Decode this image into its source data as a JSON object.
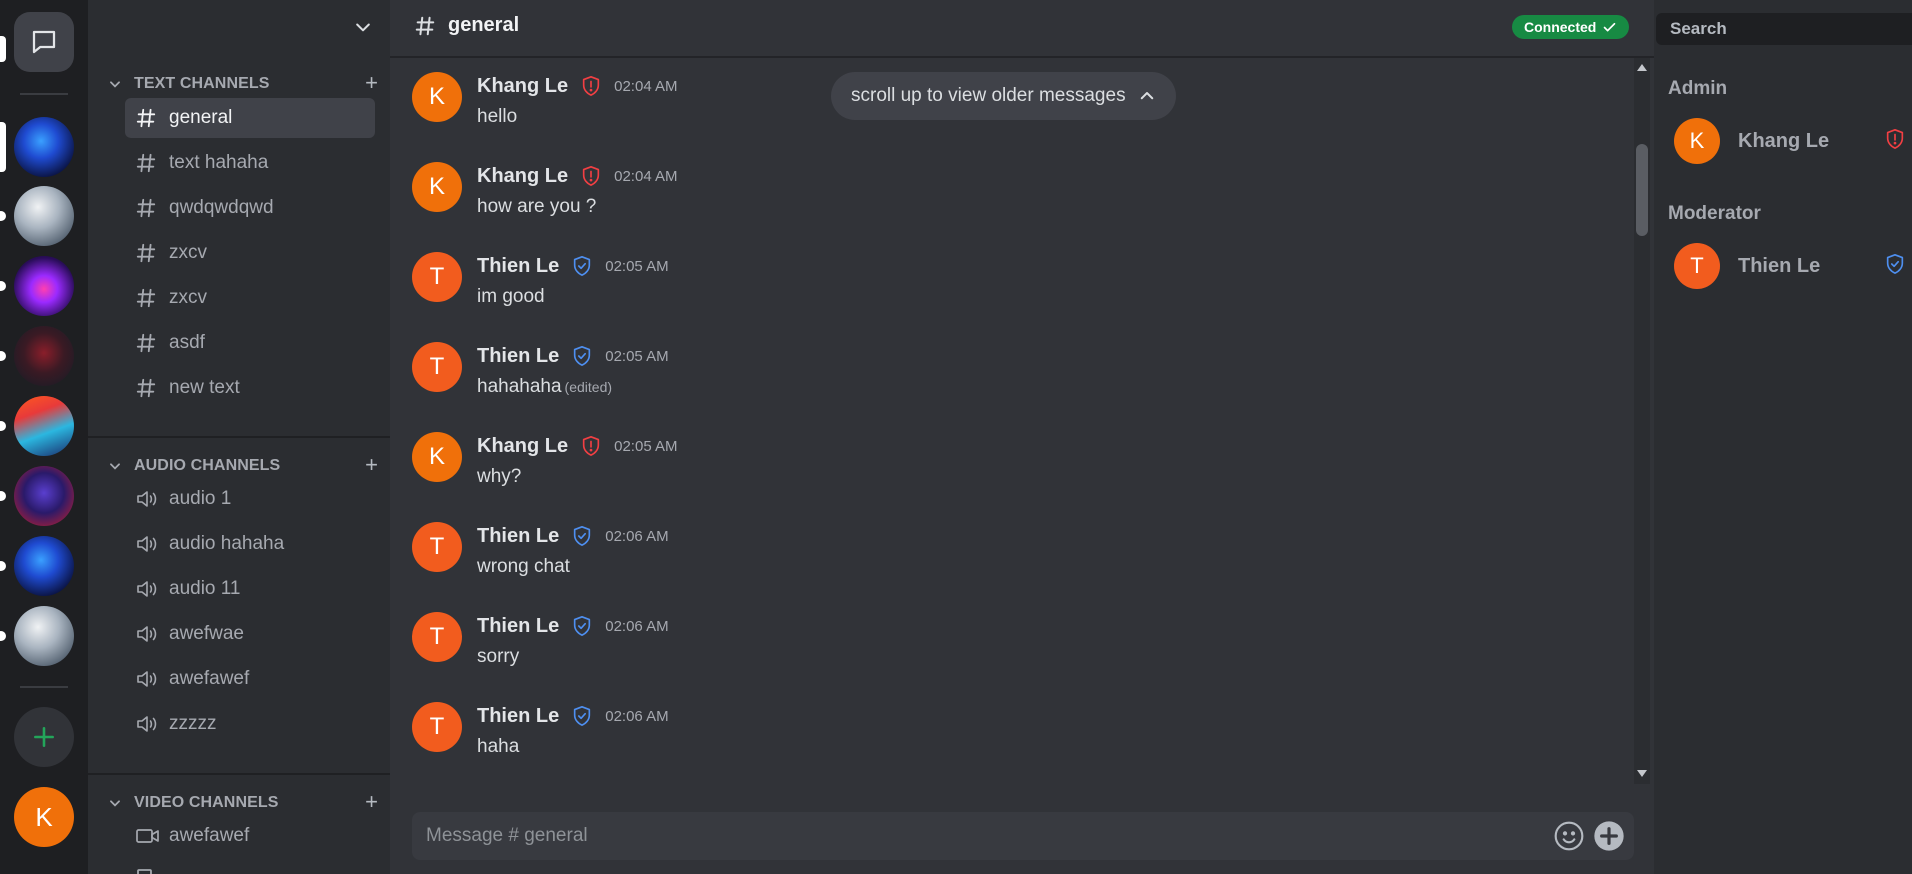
{
  "rail": {
    "tooltip": "conversation",
    "user_initial": "K",
    "server_count": 8
  },
  "sidebar": {
    "text_category": "TEXT CHANNELS",
    "text_channels": [
      "general",
      "text hahaha",
      "qwdqwdqwd",
      "zxcv",
      "zxcv",
      "asdf",
      "new text"
    ],
    "audio_category": "AUDIO CHANNELS",
    "audio_channels": [
      "audio 1",
      "audio hahaha",
      "audio 11",
      "awefwae",
      "awefawef",
      "zzzzz"
    ],
    "video_category": "VIDEO CHANNELS",
    "video_channels": [
      "awefawef"
    ]
  },
  "main": {
    "channel_title": "general",
    "status": "Connected",
    "scroll_hint": "scroll up to view older messages",
    "messages": [
      {
        "author": "Khang Le",
        "initial": "K",
        "role": "admin",
        "time": "02:04 AM",
        "text": "hello",
        "edited": ""
      },
      {
        "author": "Khang Le",
        "initial": "K",
        "role": "admin",
        "time": "02:04 AM",
        "text": "how are you ?",
        "edited": ""
      },
      {
        "author": "Thien Le",
        "initial": "T",
        "role": "moderator",
        "time": "02:05 AM",
        "text": "im good",
        "edited": ""
      },
      {
        "author": "Thien Le",
        "initial": "T",
        "role": "moderator",
        "time": "02:05 AM",
        "text": "hahahaha",
        "edited": "(edited)"
      },
      {
        "author": "Khang Le",
        "initial": "K",
        "role": "admin",
        "time": "02:05 AM",
        "text": "why?",
        "edited": ""
      },
      {
        "author": "Thien Le",
        "initial": "T",
        "role": "moderator",
        "time": "02:06 AM",
        "text": "wrong chat",
        "edited": ""
      },
      {
        "author": "Thien Le",
        "initial": "T",
        "role": "moderator",
        "time": "02:06 AM",
        "text": "sorry",
        "edited": ""
      },
      {
        "author": "Thien Le",
        "initial": "T",
        "role": "moderator",
        "time": "02:06 AM",
        "text": "haha",
        "edited": ""
      }
    ],
    "composer_placeholder": "Message # general"
  },
  "members": {
    "search_placeholder": "Search",
    "admin_title": "Admin",
    "admin": {
      "name": "Khang Le",
      "initial": "K"
    },
    "moderator_title": "Moderator",
    "moderator": {
      "name": "Thien Le",
      "initial": "T"
    }
  },
  "colors": {
    "avatar_k": "#f0700a",
    "avatar_t": "#f25c1e",
    "admin_badge": "#f23f43",
    "moderator_badge": "#4e8ff0",
    "connected": "#178a43",
    "add_server": "#23a55a"
  }
}
